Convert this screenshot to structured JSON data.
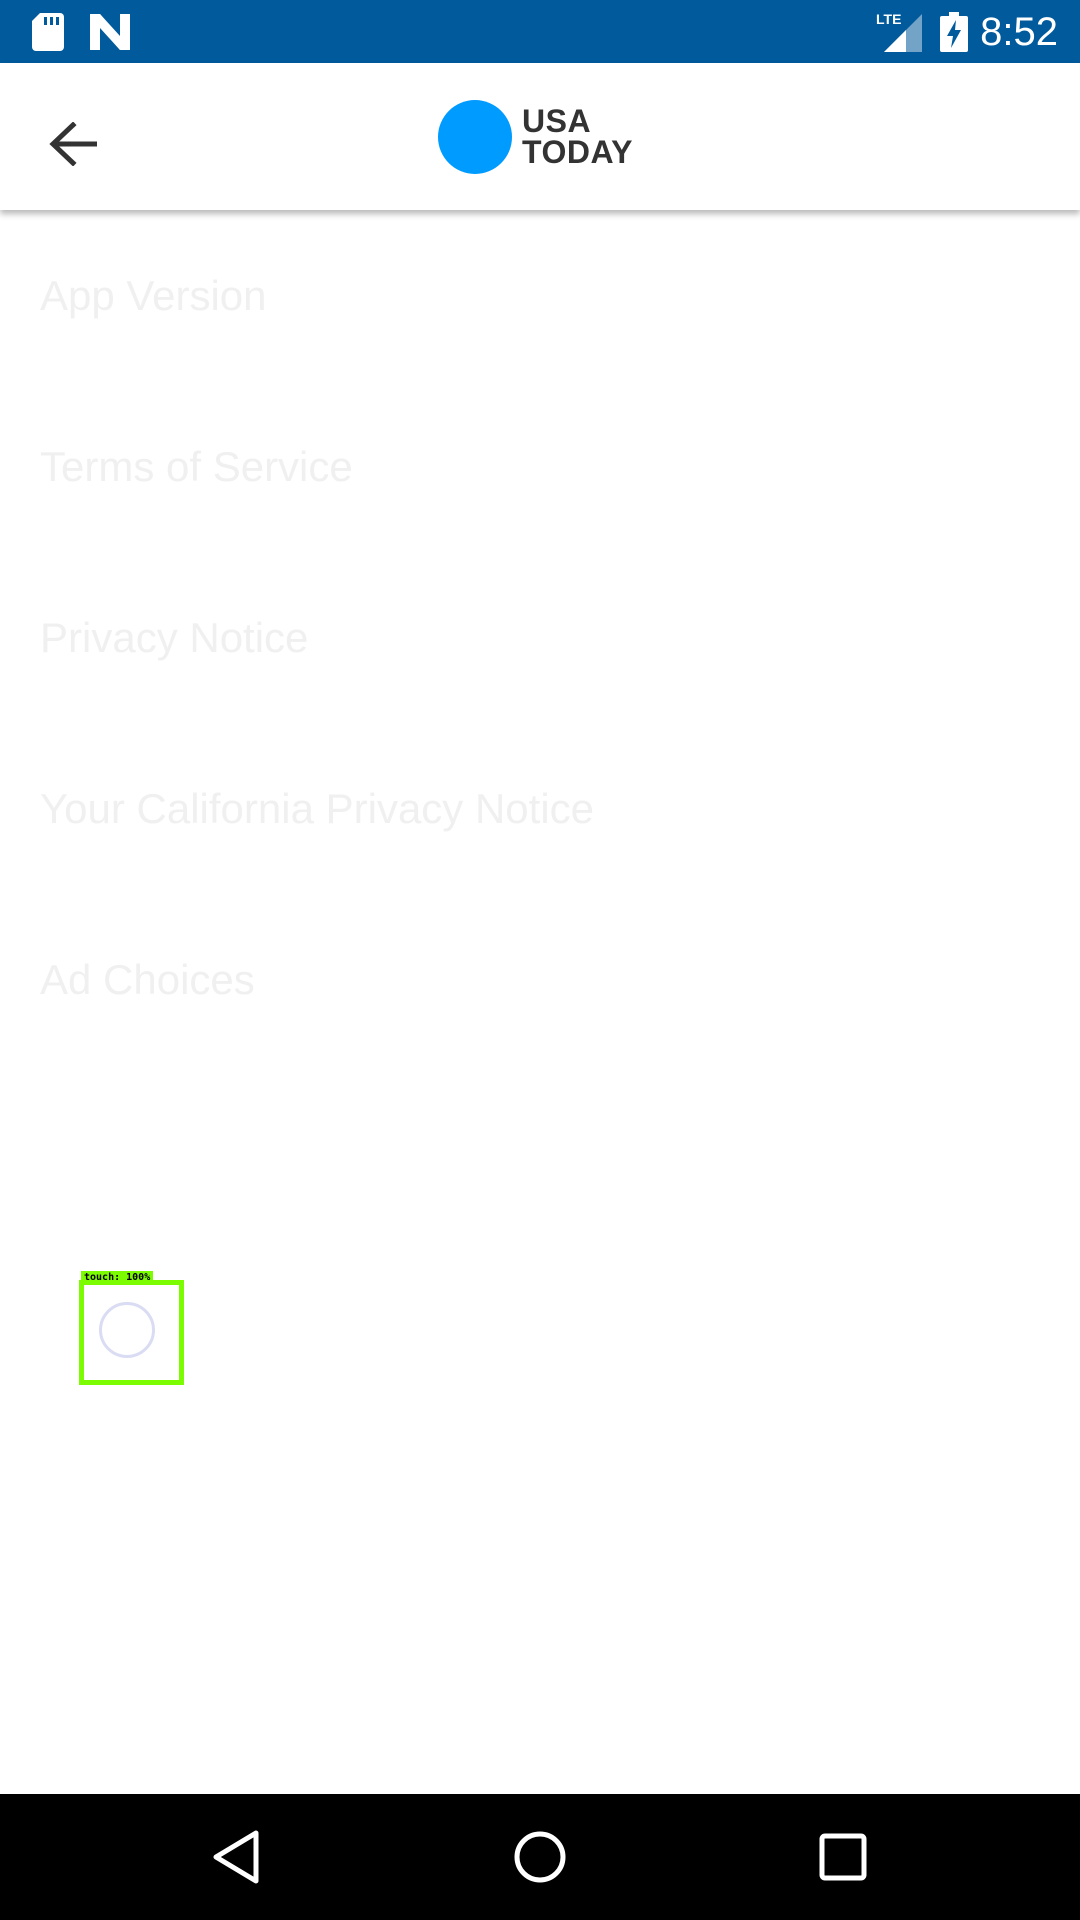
{
  "status_bar": {
    "time": "8:52",
    "network": "LTE",
    "icons": [
      "sd-card-icon",
      "n-notification-icon",
      "lte-signal-icon",
      "battery-charging-icon"
    ],
    "background": "#005a9c"
  },
  "app_bar": {
    "back_icon": "arrow-back-icon",
    "logo": {
      "line1": "USA",
      "line2": "TODAY",
      "circle_color": "#009bff"
    }
  },
  "menu": {
    "items": [
      {
        "label": "App Version"
      },
      {
        "label": "Terms of Service"
      },
      {
        "label": "Privacy Notice"
      },
      {
        "label": "Your California Privacy Notice"
      },
      {
        "label": "Ad Choices"
      }
    ]
  },
  "touch_overlay": {
    "label": "touch: 100%",
    "color": "#7cfc00"
  },
  "nav_bar": {
    "buttons": [
      "back-triangle-icon",
      "home-circle-icon",
      "recents-square-icon"
    ]
  }
}
